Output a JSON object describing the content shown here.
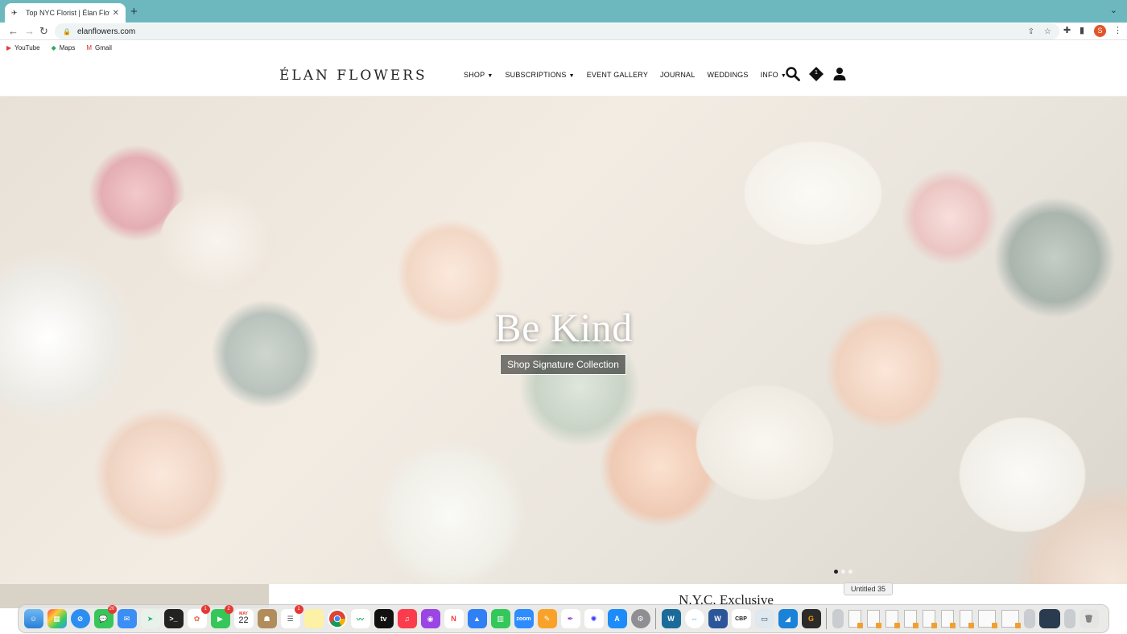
{
  "browser": {
    "tab_title": "Top NYC Florist | Élan Flowers",
    "url": "elanflowers.com",
    "profile_initial": "S",
    "bookmarks": [
      {
        "label": "YouTube",
        "icon": "youtube-icon"
      },
      {
        "label": "Maps",
        "icon": "maps-icon"
      },
      {
        "label": "Gmail",
        "icon": "gmail-icon"
      }
    ]
  },
  "site": {
    "logo": "ÉLAN FLOWERS",
    "nav": [
      {
        "label": "SHOP",
        "dropdown": true
      },
      {
        "label": "SUBSCRIPTIONS",
        "dropdown": true
      },
      {
        "label": "EVENT GALLERY",
        "dropdown": false
      },
      {
        "label": "JOURNAL",
        "dropdown": false
      },
      {
        "label": "WEDDINGS",
        "dropdown": false
      },
      {
        "label": "INFO",
        "dropdown": true
      }
    ],
    "cart_count": "1"
  },
  "hero": {
    "headline": "Be Kind",
    "cta_label": "Shop Signature Collection",
    "slide_count": 3,
    "active_slide": 1
  },
  "section": {
    "title": "N.Y.C. Exclusive"
  },
  "dock": {
    "tooltip": "Untitled 35",
    "calendar_month": "MAY",
    "calendar_day": "22",
    "badges": {
      "messages": "20",
      "photos": "1",
      "facetime": "2",
      "reminders": "1"
    },
    "labels": {
      "appletv": "tv",
      "zoom": "zoom",
      "cbp": "CBP"
    }
  },
  "colors": {
    "tabbar": "#6db8bf",
    "cta_border": "#ffffff"
  }
}
